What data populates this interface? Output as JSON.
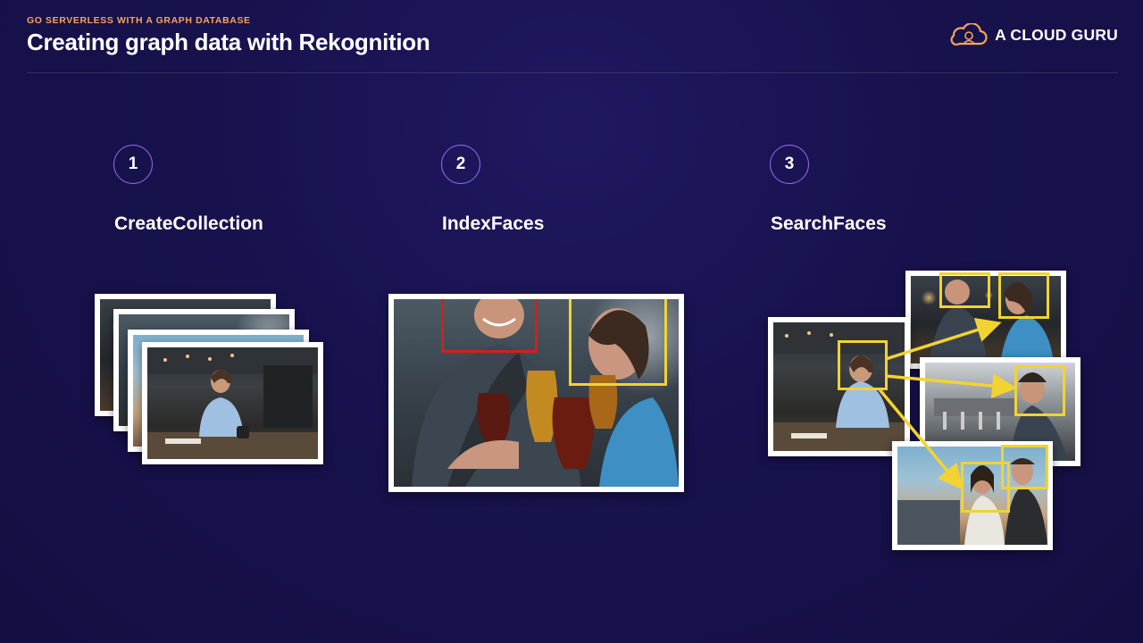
{
  "header": {
    "eyebrow": "GO SERVERLESS WITH A GRAPH DATABASE",
    "title": "Creating graph data with Rekognition",
    "brand_name": "A CLOUD GURU",
    "brand_icon": "cloud-guru-logo-icon"
  },
  "steps": [
    {
      "number": "1",
      "label": "CreateCollection",
      "image": "stack-of-photos"
    },
    {
      "number": "2",
      "label": "IndexFaces",
      "image": "photo-with-detected-faces"
    },
    {
      "number": "3",
      "label": "SearchFaces",
      "image": "face-matched-across-photos"
    }
  ],
  "colors": {
    "background": "#17124d",
    "accent_orange": "#f7a35c",
    "step_circle": "#9c6cf0",
    "face_box": "#f2d332",
    "face_box_unmatched": "#d0221c"
  }
}
